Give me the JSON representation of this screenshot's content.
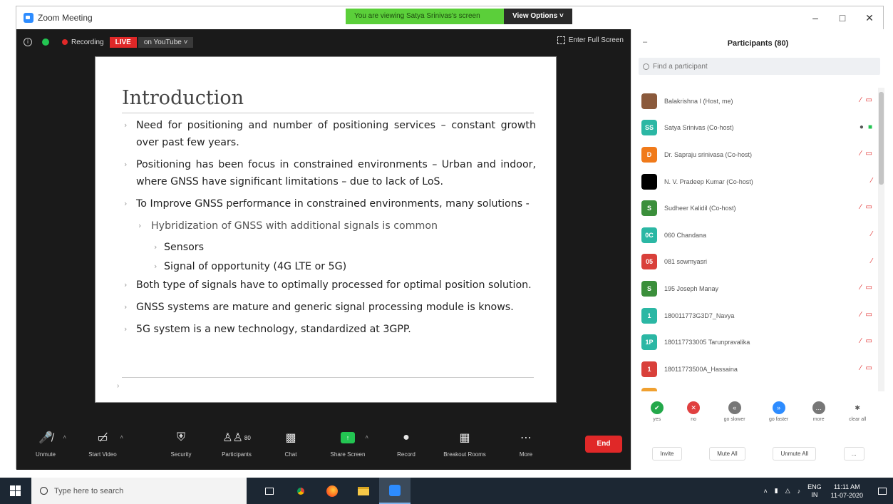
{
  "window": {
    "title": "Zoom Meeting",
    "share_banner": "You are viewing Satya Srinivas's screen",
    "view_options": "View Options ˅",
    "controls": [
      "–",
      "□",
      "✕"
    ]
  },
  "meeting_top": {
    "recording": "Recording",
    "live": "LIVE",
    "youtube": "on YouTube ˅",
    "fullscreen": "Enter Full Screen"
  },
  "slide": {
    "title": "Introduction",
    "bullets": [
      {
        "level": 0,
        "text": "Need for positioning and number of positioning services – constant growth over past few years."
      },
      {
        "level": 0,
        "text": "Positioning has been focus in constrained environments – Urban and indoor, where GNSS have significant limitations – due to lack of LoS."
      },
      {
        "level": 0,
        "text": "To Improve GNSS performance in constrained environments, many solutions -"
      },
      {
        "level": 1,
        "text": "Hybridization of GNSS with additional signals is common"
      },
      {
        "level": 2,
        "text": "Sensors"
      },
      {
        "level": 2,
        "text": "Signal of opportunity (4G LTE or 5G)"
      },
      {
        "level": 0,
        "text": "Both type of signals have to optimally processed for optimal position solution."
      },
      {
        "level": 0,
        "text": "GNSS systems are mature and generic signal processing module is knows."
      },
      {
        "level": 0,
        "text": "5G system is a new technology, standardized at 3GPP."
      }
    ]
  },
  "toolbar": {
    "unmute": "Unmute",
    "start_video": "Start Video",
    "security": "Security",
    "participants": "Participants",
    "participants_count": "80",
    "chat": "Chat",
    "share_screen": "Share Screen",
    "record": "Record",
    "breakout": "Breakout Rooms",
    "more": "More",
    "end": "End"
  },
  "participants": {
    "header": "Participants (80)",
    "search_placeholder": "Find a participant",
    "list": [
      {
        "initials": "",
        "name": "Balakrishna I (Host, me)",
        "color": "#8b5a3c",
        "mic": "off",
        "video": "off"
      },
      {
        "initials": "SS",
        "name": "Satya Srinivas (Co-host)",
        "color": "#2bb7a4",
        "mic": "on",
        "video": "on"
      },
      {
        "initials": "D",
        "name": "Dr. Sapraju srinivasa (Co-host)",
        "color": "#f07a1a",
        "mic": "off",
        "video": "off"
      },
      {
        "initials": "",
        "name": "N. V. Pradeep Kumar (Co-host)",
        "color": "#000000",
        "mic": "off",
        "video": "none"
      },
      {
        "initials": "S",
        "name": "Sudheer Kalidil (Co-host)",
        "color": "#3b8f3b",
        "mic": "off",
        "video": "off"
      },
      {
        "initials": "0C",
        "name": "060 Chandana",
        "color": "#2bb7a4",
        "mic": "off",
        "video": "none"
      },
      {
        "initials": "05",
        "name": "081 sowmyasri",
        "color": "#d9403a",
        "mic": "off",
        "video": "none"
      },
      {
        "initials": "S",
        "name": "195 Joseph Manay",
        "color": "#3b8f3b",
        "mic": "off",
        "video": "off"
      },
      {
        "initials": "1",
        "name": "180011773G3D7_Navya",
        "color": "#2bb7a4",
        "mic": "off",
        "video": "off"
      },
      {
        "initials": "1P",
        "name": "180117733005 Tarunpravalika",
        "color": "#2bb7a4",
        "mic": "off",
        "video": "off"
      },
      {
        "initials": "1",
        "name": "18011773500A_Hassaina",
        "color": "#d9403a",
        "mic": "off",
        "video": "off"
      },
      {
        "initials": "",
        "name": "",
        "color": "#f0a030",
        "mic": "none",
        "video": "none"
      }
    ],
    "reactions": [
      {
        "label": "yes",
        "color": "#23a84a",
        "glyph": "✔"
      },
      {
        "label": "no",
        "color": "#e04040",
        "glyph": "✕"
      },
      {
        "label": "go slower",
        "color": "#777777",
        "glyph": "«"
      },
      {
        "label": "go faster",
        "color": "#2d8cff",
        "glyph": "»"
      },
      {
        "label": "more",
        "color": "#777777",
        "glyph": "…"
      },
      {
        "label": "clear all",
        "color": "#ffffff",
        "glyph": "✱"
      }
    ],
    "footer": [
      "Invite",
      "Mute All",
      "Unmute All",
      "..."
    ]
  },
  "taskbar": {
    "search_placeholder": "Type here to search",
    "lang": "ENG",
    "lang2": "IN",
    "time": "11:11 AM",
    "date": "11-07-2020"
  }
}
